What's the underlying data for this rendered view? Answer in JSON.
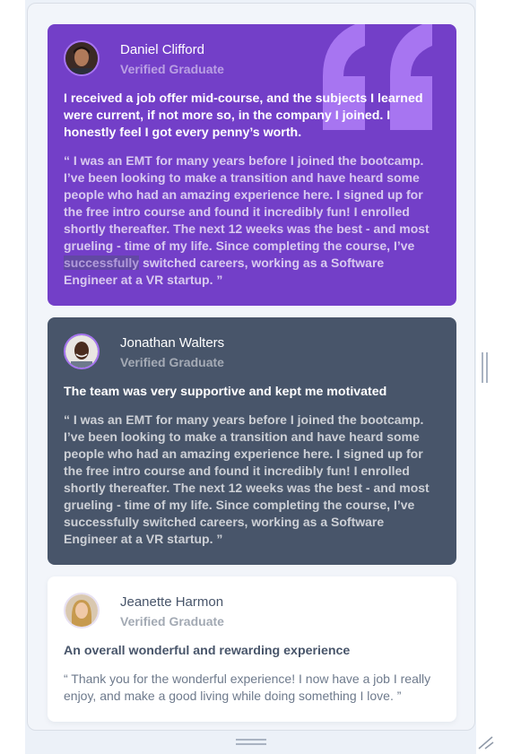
{
  "colors": {
    "purple": "#733fc8",
    "slate": "#48556a",
    "white": "#ffffff",
    "page_bg": "#ecf1f8",
    "quote_mark": "#a775f1"
  },
  "testimonials": [
    {
      "name": "Daniel Clifford",
      "role": "Verified Graduate",
      "headline": "I received a job offer mid-course, and the subjects I learned were current, if not more so, in the company I joined. I honestly feel I got every penny’s worth.",
      "body_before_highlight": "“ I was an EMT for many years before I joined the bootcamp. I’ve been looking to make a transition and have heard some people who had an amazing experience here. I signed up for the free intro course and found it incredibly fun! I enrolled shortly thereafter. The next 12 weeks was the best - and most grueling - time of my life. Since completing the course, I’ve ",
      "body_highlight": "successfully",
      "body_after_highlight": " switched careers, working as a Software Engineer at a VR startup. ”"
    },
    {
      "name": "Jonathan Walters",
      "role": "Verified Graduate",
      "headline": "The team was very supportive and kept me motivated",
      "body": "“ I was an EMT for many years before I joined the bootcamp. I’ve been looking to make a transition and have heard some people who had an amazing experience here. I signed up for the free intro course and found it incredibly fun! I enrolled shortly thereafter. The next 12 weeks was the best - and most grueling - time of my life. Since completing the course, I’ve successfully switched careers, working as a Software Engineer at a VR startup. ”"
    },
    {
      "name": "Jeanette Harmon",
      "role": "Verified Graduate",
      "headline": "An overall wonderful and rewarding experience",
      "body": "“ Thank you for the wonderful experience! I now have a job I really enjoy, and make a good living while doing something I love. ”"
    }
  ]
}
